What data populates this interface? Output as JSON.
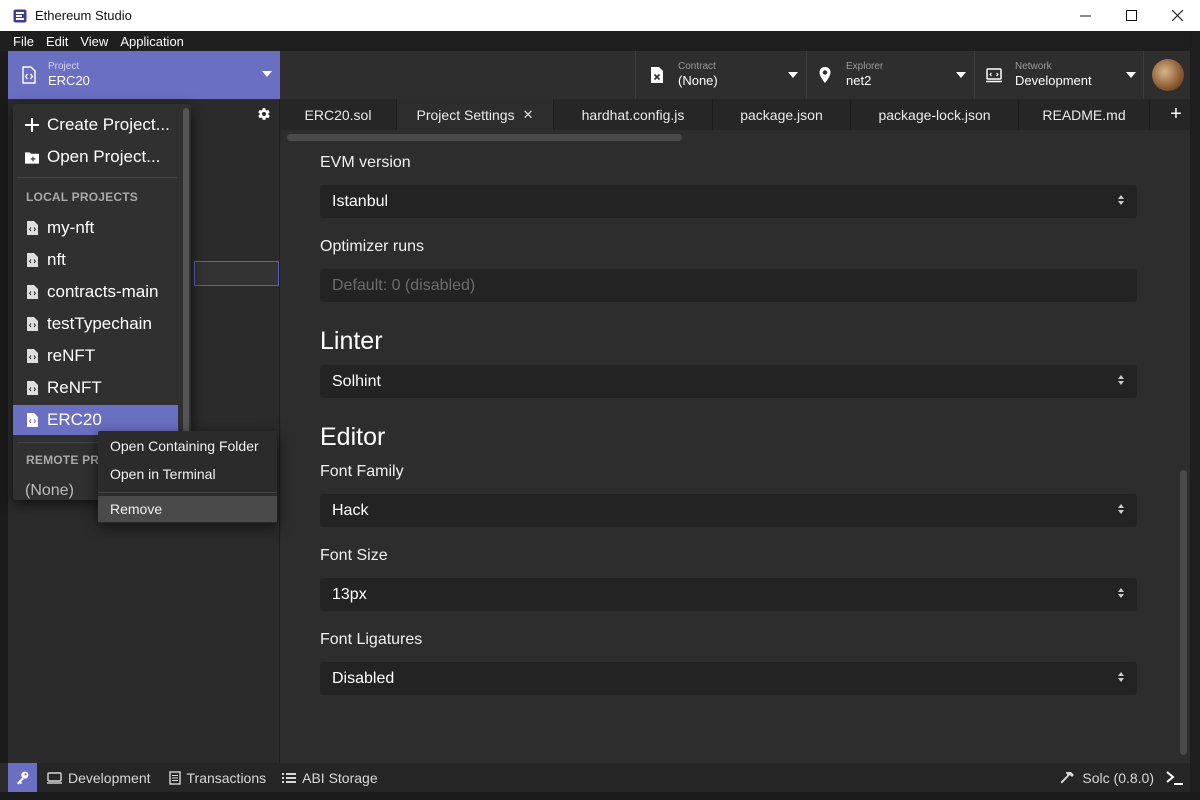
{
  "window": {
    "title": "Ethereum Studio",
    "minimize": "─",
    "maximize": "☐",
    "close": "✕"
  },
  "menu": [
    "File",
    "Edit",
    "View",
    "Application"
  ],
  "header": {
    "project": {
      "label": "Project",
      "value": "ERC20"
    },
    "contract": {
      "label": "Contract",
      "value": "(None)"
    },
    "explorer": {
      "label": "Explorer",
      "value": "net2"
    },
    "network": {
      "label": "Network",
      "value": "Development"
    }
  },
  "tabs": [
    {
      "label": "ERC20.sol",
      "active": false
    },
    {
      "label": "Project Settings",
      "active": true
    },
    {
      "label": "hardhat.config.js",
      "active": false
    },
    {
      "label": "package.json",
      "active": false
    },
    {
      "label": "package-lock.json",
      "active": false
    },
    {
      "label": "README.md",
      "active": false
    }
  ],
  "tab_close": "✕",
  "tab_add": "+",
  "dropdown": {
    "create": "Create Project...",
    "open": "Open Project...",
    "local_heading": "LOCAL PROJECTS",
    "local_projects": [
      "my-nft",
      "nft",
      "contracts-main",
      "testTypechain",
      "reNFT",
      "ReNFT",
      "ERC20"
    ],
    "remote_heading": "REMOTE PROJECTS",
    "remote_value": "(None)"
  },
  "context_menu": {
    "open_folder": "Open Containing Folder",
    "open_terminal": "Open in Terminal",
    "remove": "Remove"
  },
  "settings": {
    "evm_label": "EVM version",
    "evm_value": "Istanbul",
    "optimizer_label": "Optimizer runs",
    "optimizer_placeholder": "Default: 0 (disabled)",
    "linter_heading": "Linter",
    "linter_value": "Solhint",
    "editor_heading": "Editor",
    "font_family_label": "Font Family",
    "font_family_value": "Hack",
    "font_size_label": "Font Size",
    "font_size_value": "13px",
    "ligatures_label": "Font Ligatures",
    "ligatures_value": "Disabled"
  },
  "statusbar": {
    "development": "Development",
    "transactions": "Transactions",
    "abi_storage": "ABI Storage",
    "compiler": "Solc (0.8.0)"
  },
  "colors": {
    "accent": "#6b6fc2",
    "background": "#2d2d2d",
    "sidebar": "#2b2b2b"
  }
}
